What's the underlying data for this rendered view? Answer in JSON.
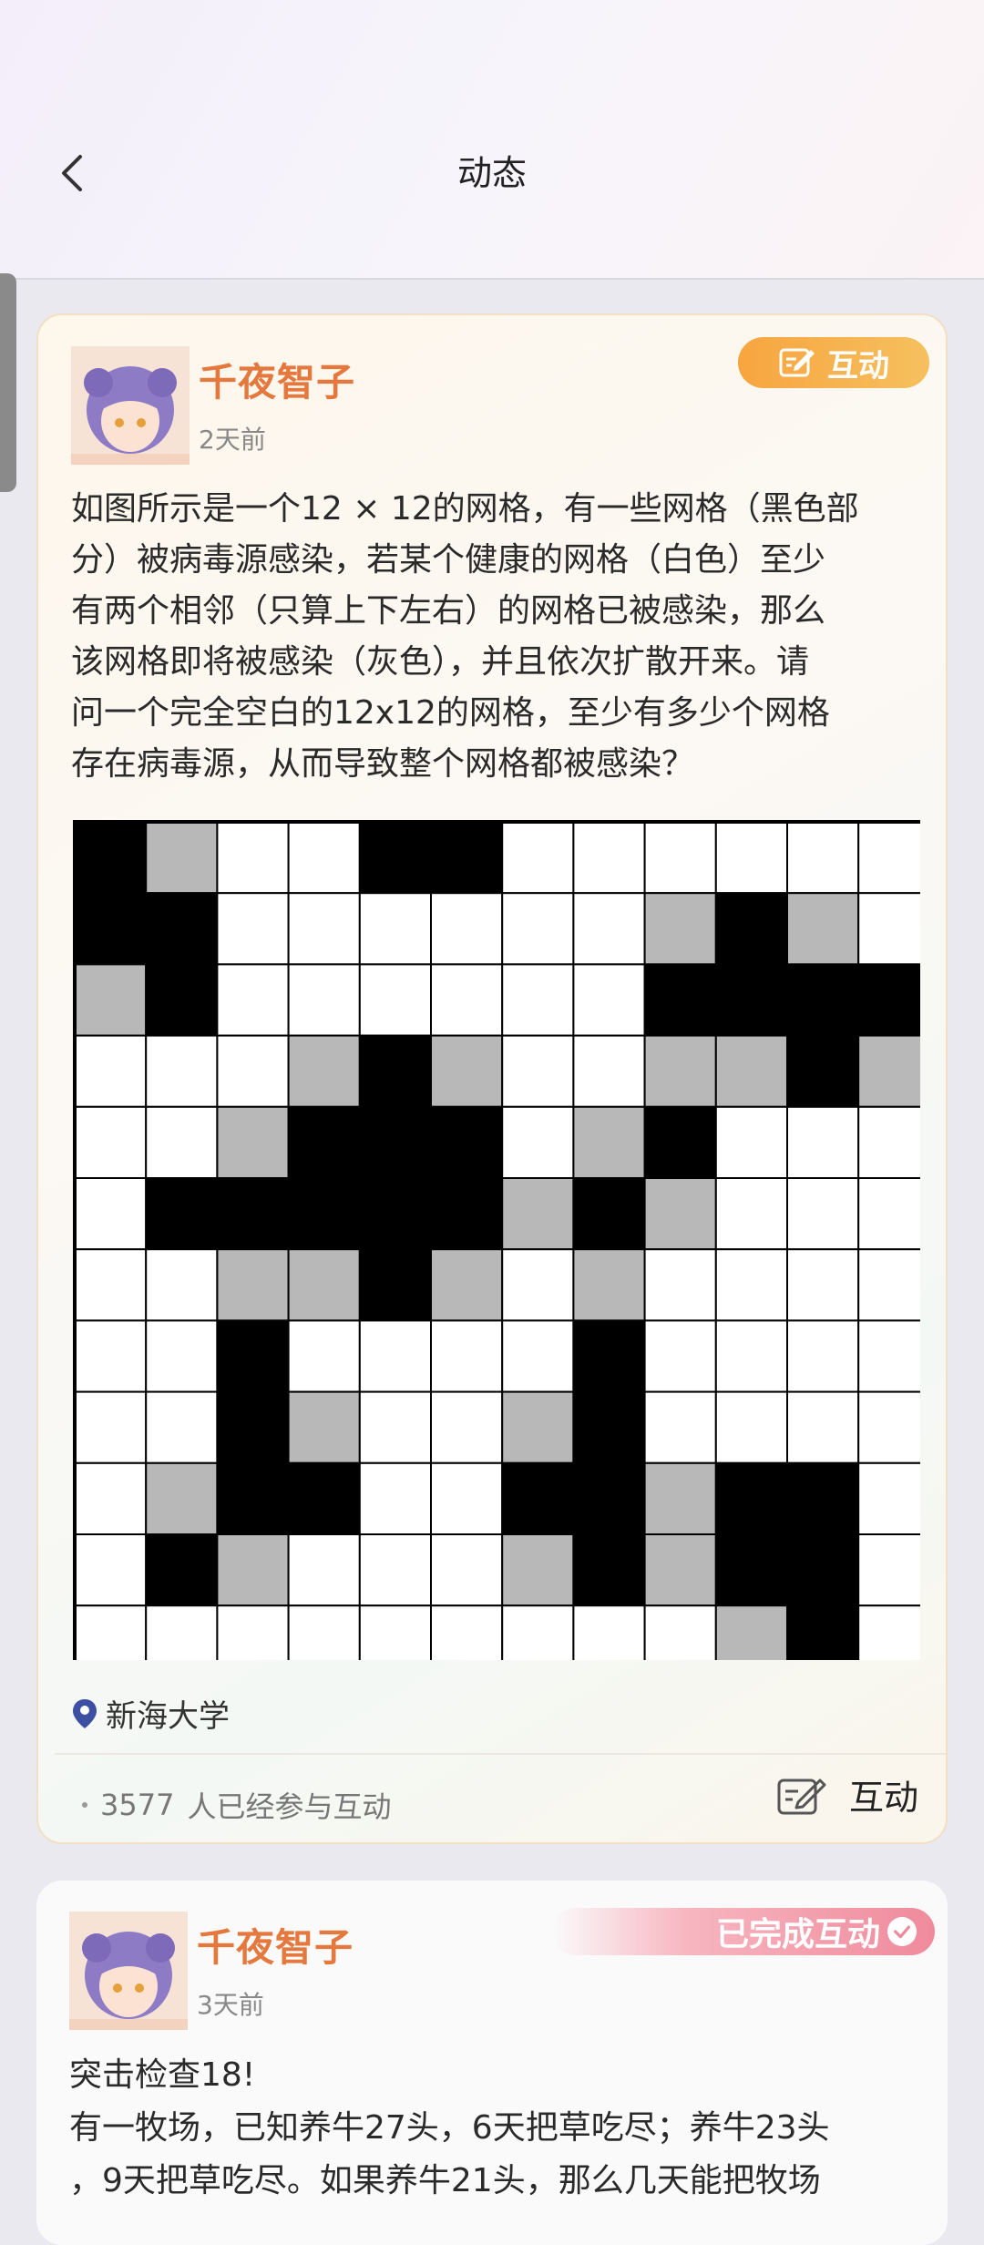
{
  "header": {
    "title": "动态"
  },
  "post1": {
    "author": "千夜智子",
    "time": "2天前",
    "badge": "互动",
    "text": "如图所示是一个12 × 12的网格，有一些网格（黑色部\n分）被病毒源感染，若某个健康的网格（白色）至少\n有两个相邻（只算上下左右）的网格已被感染，那么\n该网格即将被感染（灰色），并且依次扩散开来。请\n问一个完全空白的12x12的网格，至少有多少个网格\n存在病毒源，从而导致整个网格都被感染？",
    "location": "新海大学",
    "participants_count": "3577",
    "participants_text": "人已经参与互动",
    "interact_label": "互动",
    "grid": [
      "BGWWBBWWWWWW",
      "BBWWWWWWGBGW",
      "GBWWWWWWBBBB",
      "WWWGBGWWGGBG",
      "WWGBBBWGBWWW",
      "WBBBBBGBGWWW",
      "WWGGBGWGWWWW",
      "WWBWWWWBWWWW",
      "WWBGWWGBWWWW",
      "WGBBWWBBGBBW",
      "WBGWWWGBGBBW",
      "WWWWWWWWWGBW"
    ],
    "colors": {
      "B": "#000000",
      "G": "#b8b8b8",
      "W": "#ffffff"
    }
  },
  "post2": {
    "author": "千夜智子",
    "time": "3天前",
    "badge": "已完成互动",
    "text": "突击检查18!\n有一牧场，已知养牛27头，6天把草吃尽；养牛23头\n，9天把草吃尽。如果养牛21头，那么几天能把牧场"
  }
}
